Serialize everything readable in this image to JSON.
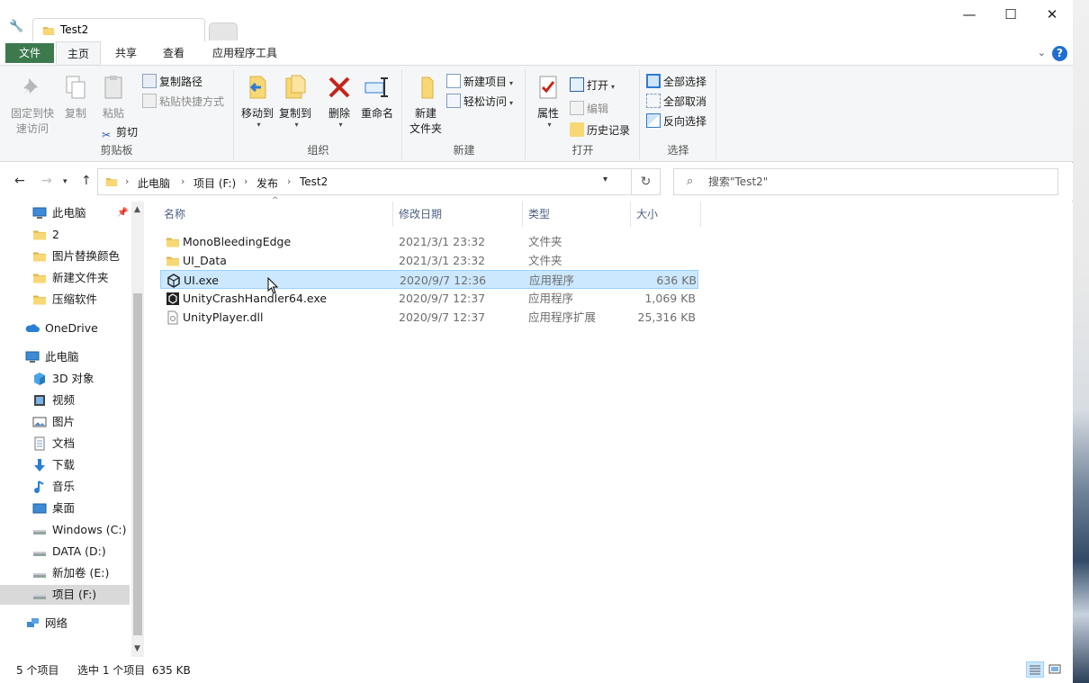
{
  "window": {
    "tab_title": "Test2",
    "controls": {
      "minimize": "—",
      "maximize": "☐",
      "close": "✕"
    }
  },
  "ribbon_tabs": [
    "文件",
    "主页",
    "共享",
    "查看",
    "应用程序工具"
  ],
  "ribbon": {
    "clipboard": {
      "label": "剪贴板",
      "pin": "固定到快\n速访问",
      "pin_l1": "固定到快",
      "pin_l2": "速访问",
      "copy": "复制",
      "paste": "粘贴",
      "copy_path": "复制路径",
      "paste_shortcut": "粘贴快捷方式",
      "cut": "剪切"
    },
    "organize": {
      "label": "组织",
      "move_to": "移动到",
      "copy_to": "复制到",
      "delete": "删除",
      "rename": "重命名"
    },
    "new": {
      "label": "新建",
      "new_folder_l1": "新建",
      "new_folder_l2": "文件夹",
      "new_item": "新建项目",
      "easy_access": "轻松访问"
    },
    "open": {
      "label": "打开",
      "properties": "属性",
      "open": "打开",
      "edit": "编辑",
      "history": "历史记录"
    },
    "select": {
      "label": "选择",
      "select_all": "全部选择",
      "select_none": "全部取消",
      "invert": "反向选择"
    }
  },
  "address": {
    "crumbs": [
      "此电脑",
      "项目 (F:)",
      "发布",
      "Test2"
    ],
    "search_placeholder": "搜索\"Test2\""
  },
  "nav_pane": {
    "quick_access": [
      {
        "label": "此电脑",
        "icon": "pc-icon"
      },
      {
        "label": "2",
        "icon": "folder-icon"
      },
      {
        "label": "图片替换颜色",
        "icon": "folder-icon"
      },
      {
        "label": "新建文件夹",
        "icon": "folder-icon"
      },
      {
        "label": "压缩软件",
        "icon": "folder-icon"
      }
    ],
    "onedrive": "OneDrive",
    "this_pc": "此电脑",
    "pc_items": [
      {
        "label": "3D 对象",
        "icon": "cube-icon"
      },
      {
        "label": "视频",
        "icon": "video-icon"
      },
      {
        "label": "图片",
        "icon": "picture-icon"
      },
      {
        "label": "文档",
        "icon": "document-icon"
      },
      {
        "label": "下载",
        "icon": "download-icon"
      },
      {
        "label": "音乐",
        "icon": "music-icon"
      },
      {
        "label": "桌面",
        "icon": "desktop-icon"
      },
      {
        "label": "Windows (C:)",
        "icon": "drive-icon"
      },
      {
        "label": "DATA (D:)",
        "icon": "drive-icon"
      },
      {
        "label": "新加卷 (E:)",
        "icon": "drive-icon"
      },
      {
        "label": "项目 (F:)",
        "icon": "drive-icon"
      }
    ],
    "network": "网络"
  },
  "file_list": {
    "columns": [
      "名称",
      "修改日期",
      "类型",
      "大小"
    ],
    "rows": [
      {
        "name": "MonoBleedingEdge",
        "date": "2021/3/1 23:32",
        "type": "文件夹",
        "size": "",
        "icon": "folder-icon"
      },
      {
        "name": "UI_Data",
        "date": "2021/3/1 23:32",
        "type": "文件夹",
        "size": "",
        "icon": "folder-icon"
      },
      {
        "name": "UI.exe",
        "date": "2020/9/7 12:36",
        "type": "应用程序",
        "size": "636 KB",
        "icon": "unity-icon"
      },
      {
        "name": "UnityCrashHandler64.exe",
        "date": "2020/9/7 12:37",
        "type": "应用程序",
        "size": "1,069 KB",
        "icon": "unity-dark-icon"
      },
      {
        "name": "UnityPlayer.dll",
        "date": "2020/9/7 12:37",
        "type": "应用程序扩展",
        "size": "25,316 KB",
        "icon": "dll-icon"
      }
    ]
  },
  "status": {
    "count": "5 个项目",
    "selection": "选中 1 个项目  635 KB"
  },
  "colors": {
    "file_tab": "#3c7a4d",
    "selection_bg": "#cce8ff",
    "selection_border": "#99d1ff",
    "folder": "#f8d775",
    "help": "#1f6fd1"
  }
}
